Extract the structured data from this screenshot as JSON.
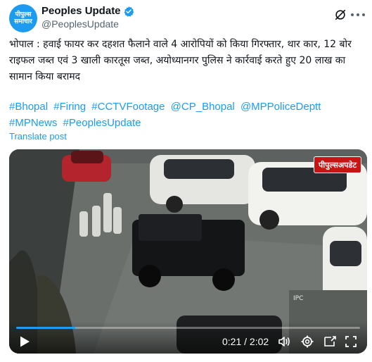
{
  "account": {
    "avatar_line1": "पीपुल्स",
    "avatar_line2": "समाचार",
    "display_name": "Peoples Update",
    "handle": "@PeoplesUpdate",
    "verified": true
  },
  "icons": {
    "verified": "verified-badge-icon",
    "grok": "grok-icon",
    "more": "more-options-icon",
    "play": "play-icon",
    "volume": "volume-icon",
    "settings": "settings-gear-icon",
    "pip": "picture-in-picture-icon",
    "fullscreen": "fullscreen-icon"
  },
  "tweet": {
    "text": "भोपाल : हवाई फायर कर दहशत फैलाने वाले 4 आरोपियों को किया गिरफ्तार, थार कार, 12 बोर राइफल जब्त एवं 3 खाली कारतूस जब्त, अयोध्यानगर पुलिस ने कार्रवाई करते हुए 20 लाख का सामान किया बरामद",
    "hashtags": [
      "#Bhopal",
      "#Firing",
      "#CCTVFootage",
      "@CP_Bhopal",
      "@MPPoliceDeptt",
      "#MPNews",
      "#PeoplesUpdate"
    ],
    "translate_label": "Translate post"
  },
  "video": {
    "watermark": "पीपुल्सअपडेट",
    "overlay_label": "IPC",
    "current_time": "0:21",
    "duration": "2:02",
    "time_display": "0:21 / 2:02",
    "progress_fraction": 0.172
  },
  "colors": {
    "accent": "#1d9bf0",
    "text": "#0f1419",
    "secondary_text": "#536471",
    "watermark_red": "#c91414"
  }
}
